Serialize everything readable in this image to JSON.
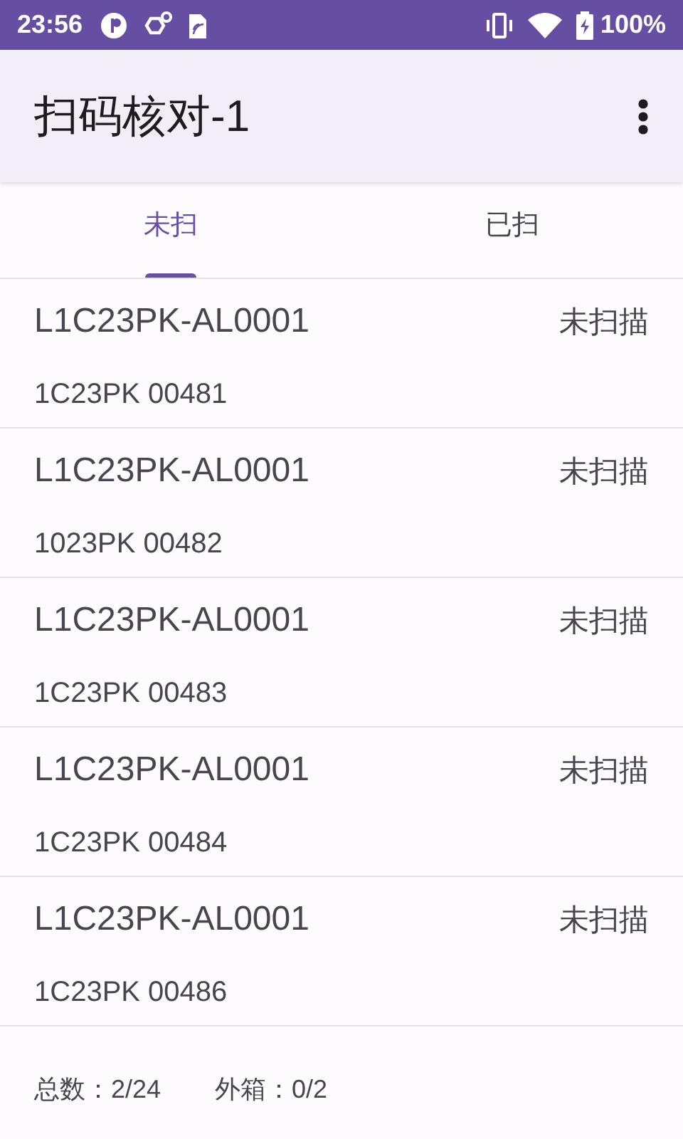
{
  "status_bar": {
    "time": "23:56",
    "battery": "100%"
  },
  "app_bar": {
    "title": "扫码核对-1"
  },
  "tabs": [
    {
      "label": "未扫",
      "selected": true
    },
    {
      "label": "已扫",
      "selected": false
    }
  ],
  "items": [
    {
      "code": "L1C23PK-AL0001",
      "serial": "1C23PK 00481",
      "status": "未扫描"
    },
    {
      "code": "L1C23PK-AL0001",
      "serial": "1023PK 00482",
      "status": "未扫描"
    },
    {
      "code": "L1C23PK-AL0001",
      "serial": "1C23PK 00483",
      "status": "未扫描"
    },
    {
      "code": "L1C23PK-AL0001",
      "serial": "1C23PK 00484",
      "status": "未扫描"
    },
    {
      "code": "L1C23PK-AL0001",
      "serial": "1C23PK 00486",
      "status": "未扫描"
    }
  ],
  "footer": {
    "total": "总数：2/24",
    "cartons": "外箱：0/2"
  }
}
